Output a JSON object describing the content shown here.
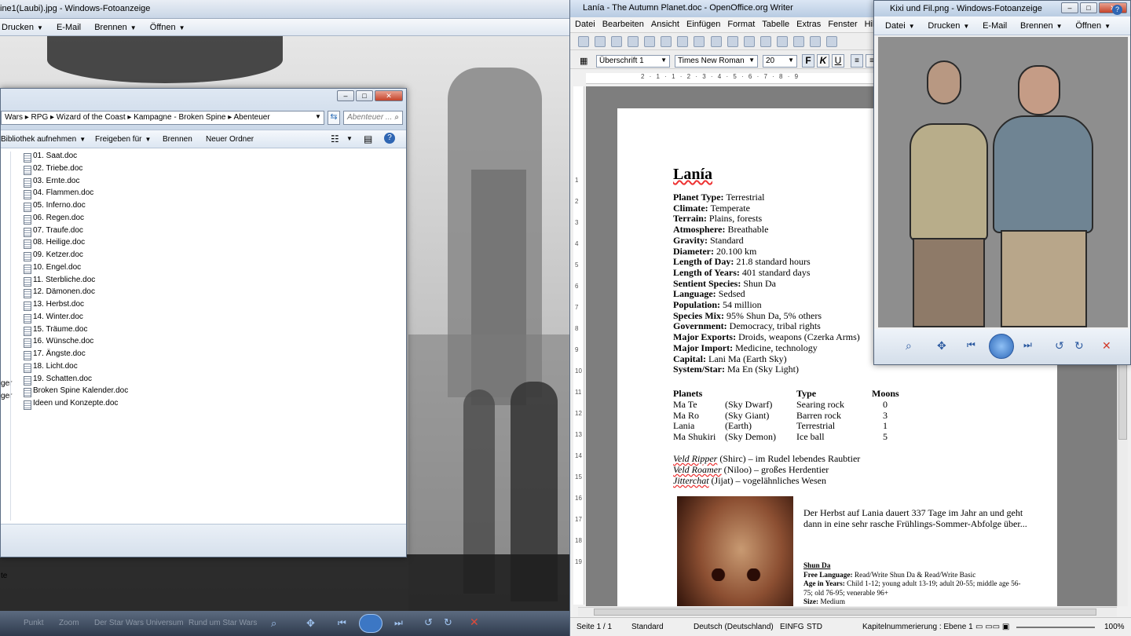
{
  "bg_viewer": {
    "title": "ine1(Laubi).jpg - Windows-Fotoanzeige",
    "menu": [
      "Drucken",
      "E-Mail",
      "Brennen",
      "Öffnen"
    ],
    "bottom_labels": [
      "Punkt",
      "Zoom",
      "Der Star Wars Universum",
      "Rund um Star Wars"
    ]
  },
  "explorer": {
    "breadcrumb": [
      "Wars",
      "RPG",
      "Wizard of the Coast",
      "Kampagne - Broken Spine",
      "Abenteuer"
    ],
    "search_placeholder": "Abenteuer ...",
    "commands": [
      "Bibliothek aufnehmen",
      "Freigeben für",
      "Brennen",
      "Neuer Ordner"
    ],
    "side_fragments": [
      "ger",
      "ger"
    ],
    "status_fragment": "te",
    "files": [
      "01. Saat.doc",
      "02. Triebe.doc",
      "03. Ernte.doc",
      "04. Flammen.doc",
      "05. Inferno.doc",
      "06. Regen.doc",
      "07. Traufe.doc",
      "08. Heilige.doc",
      "09. Ketzer.doc",
      "10. Engel.doc",
      "11. Sterbliche.doc",
      "12. Dämonen.doc",
      "13. Herbst.doc",
      "14. Winter.doc",
      "15. Träume.doc",
      "16. Wünsche.doc",
      "17. Ängste.doc",
      "18. Licht.doc",
      "19. Schatten.doc",
      "Broken Spine Kalender.doc",
      "Ideen und Konzepte.doc"
    ]
  },
  "writer": {
    "title": "Lanía - The Autumn Planet.doc - OpenOffice.org Writer",
    "menu": [
      "Datei",
      "Bearbeiten",
      "Ansicht",
      "Einfügen",
      "Format",
      "Tabelle",
      "Extras",
      "Fenster",
      "Hilfe"
    ],
    "style_value": "Überschrift 1",
    "font_value": "Times New Roman",
    "size_value": "20",
    "bold": "F",
    "italic": "K",
    "underline": "U",
    "ruler": "2 · 1 · 1 · 2 · 3 · 4 · 5 · 6 · 7 · 8 · 9",
    "doc": {
      "heading": "Lanía",
      "facts": [
        {
          "k": "Planet Type:",
          "v": "Terrestrial"
        },
        {
          "k": "Climate:",
          "v": "Temperate"
        },
        {
          "k": "Terrain:",
          "v": "Plains, forests"
        },
        {
          "k": "Atmosphere:",
          "v": "Breathable"
        },
        {
          "k": "Gravity:",
          "v": "Standard"
        },
        {
          "k": "Diameter:",
          "v": "20.100 km"
        },
        {
          "k": "Length of Day:",
          "v": "21.8 standard hours"
        },
        {
          "k": "Length of Years:",
          "v": "401 standard days"
        },
        {
          "k": "Sentient Species:",
          "v": "Shun Da"
        },
        {
          "k": "Language:",
          "v": "Sedsed"
        },
        {
          "k": "Population:",
          "v": "54 million"
        },
        {
          "k": "Species Mix:",
          "v": "95% Shun Da, 5% others"
        },
        {
          "k": "Government:",
          "v": "Democracy, tribal rights"
        },
        {
          "k": "Major Exports:",
          "v": "Droids, weapons (Czerka Arms)"
        },
        {
          "k": "Major Import:",
          "v": "Medicine, technology"
        },
        {
          "k": "Capital:",
          "v": "Lani Ma (Earth Sky)"
        },
        {
          "k": "System/Star:",
          "v": "Ma En (Sky Light)"
        }
      ],
      "planet_headers": [
        "Planets",
        "Type",
        "Moons"
      ],
      "planets": [
        {
          "name": "Ma Te",
          "alias": "(Sky Dwarf)",
          "type": "Searing rock",
          "moons": "0"
        },
        {
          "name": "Ma Ro",
          "alias": "(Sky Giant)",
          "type": "Barren rock",
          "moons": "3"
        },
        {
          "name": "Lania",
          "alias": "(Earth)",
          "type": "Terrestrial",
          "moons": "1"
        },
        {
          "name": "Ma Shukiri",
          "alias": "(Sky Demon)",
          "type": "Ice ball",
          "moons": "5"
        }
      ],
      "fauna": [
        {
          "name": "Veld Ripper",
          "rest": " (Shirc) – im Rudel lebendes Raubtier"
        },
        {
          "name": "Veld Roamer",
          "rest": " (Niloo) – großes Herdentier"
        },
        {
          "name": "Jitterchat",
          "rest": " (Jijat) – vogelähnliches Wesen"
        }
      ],
      "herbst": "Der Herbst auf Lania dauert 337 Tage im Jahr an und geht dann in eine sehr rasche Frühlings-Sommer-Abfolge über...",
      "shun_title": "Shun Da",
      "shun_lines": [
        {
          "k": "Free Language:",
          "v": " Read/Write Shun Da & Read/Write Basic"
        },
        {
          "k": "Age in Years:",
          "v": " Child 1-12; young adult 13-19; adult 20-55; middle age 56- 75; old 76-95; venerable 96+"
        },
        {
          "k": "Size:",
          "v": " Medium"
        }
      ]
    },
    "status": [
      "Seite 1 / 1",
      "Standard",
      "Deutsch (Deutschland)",
      "EINFG",
      "STD",
      "Kapitelnummerierung : Ebene 1",
      "100%"
    ]
  },
  "viewer2": {
    "title": "Kixi und Fil.png - Windows-Fotoanzeige",
    "menu": [
      "Datei",
      "Drucken",
      "E-Mail",
      "Brennen",
      "Öffnen"
    ]
  }
}
